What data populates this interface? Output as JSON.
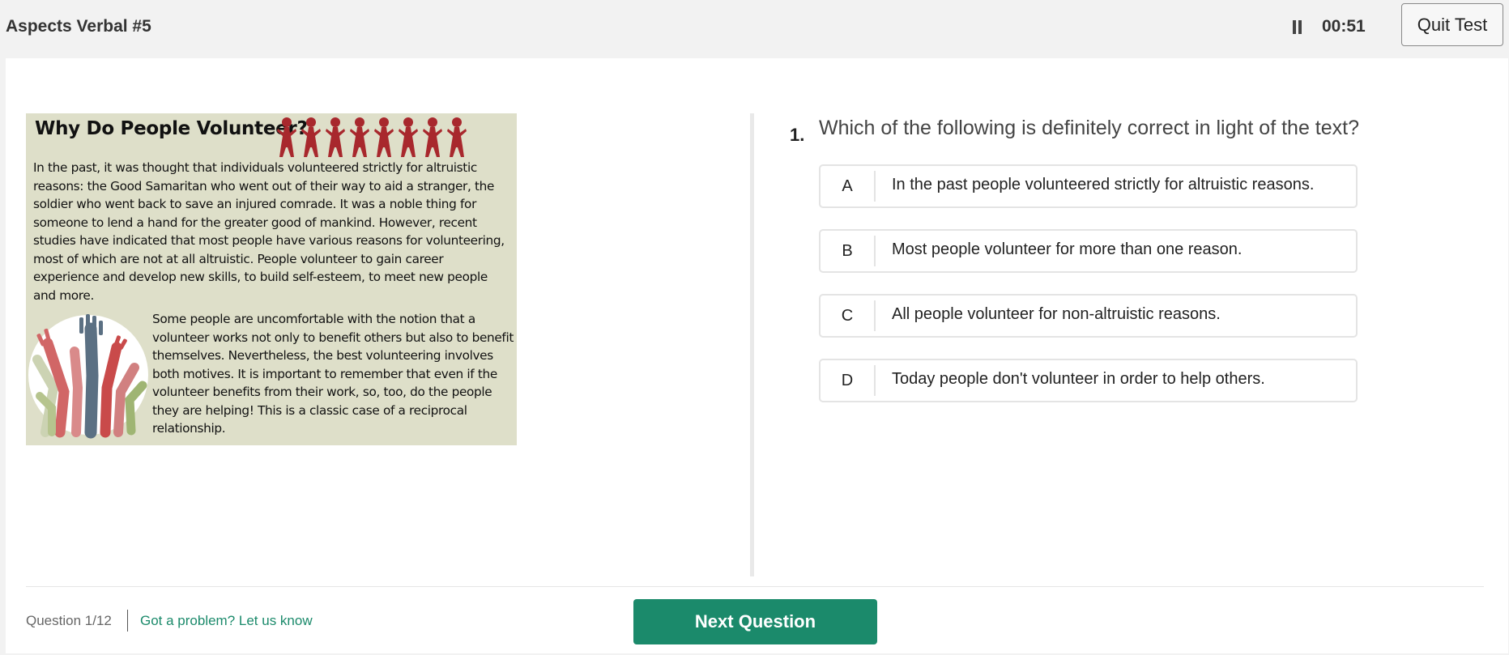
{
  "header": {
    "title": "Aspects Verbal #5",
    "timer": "00:51",
    "quit_label": "Quit Test"
  },
  "passage": {
    "title": "Why Do People Volunteer?",
    "paragraph1": "In the past, it was thought that individuals volunteered strictly for altruistic reasons: the Good Samaritan who went out of their way to aid a stranger, the soldier who went back to save an injured comrade. It was a noble thing for someone to lend a hand for the greater good of mankind. However, recent studies have indicated that most people have various reasons for volunteering, most of which are not at all altruistic. People volunteer to gain career experience and develop new skills, to build self-esteem, to meet new people and more.",
    "paragraph2": "Some people are uncomfortable with the notion that a volunteer works not only to benefit others but also to benefit themselves. Nevertheless, the best volunteering involves both motives.  It is important to remember that even if the volunteer benefits from their work, so, too, do the people they are helping! This is a classic case of a reciprocal relationship."
  },
  "question": {
    "number": "1.",
    "text": "Which of the following is definitely correct in light of the text?",
    "options": [
      {
        "letter": "A",
        "text": "In the past people volunteered strictly for altruistic reasons."
      },
      {
        "letter": "B",
        "text": "Most people volunteer for more than one reason."
      },
      {
        "letter": "C",
        "text": "All people volunteer for non-altruistic reasons."
      },
      {
        "letter": "D",
        "text": "Today people don't volunteer in order to help others."
      }
    ]
  },
  "footer": {
    "progress": "Question 1/12",
    "problem_link": "Got a problem? Let us know",
    "next_label": "Next Question"
  },
  "colors": {
    "accent": "#1b8a6b",
    "passage_bg": "#dedfc9",
    "figures": "#a8282d"
  },
  "icons": [
    "pause-icon",
    "paper-people-chain-illustration",
    "raised-hands-illustration"
  ]
}
